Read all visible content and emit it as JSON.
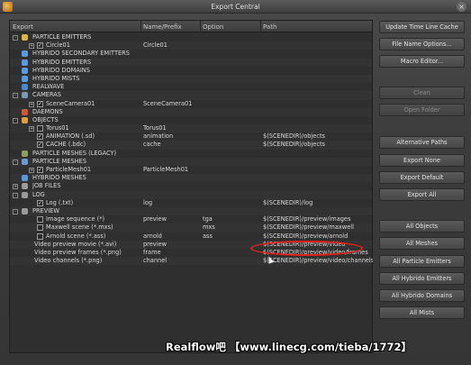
{
  "window": {
    "title": "Export Central"
  },
  "columns": {
    "export": "Export",
    "prefix": "Name/Prefix",
    "option": "Option",
    "path": "Path"
  },
  "rows": [
    {
      "level": "cat",
      "name": "PARTICLE EMITTERS",
      "toggle": "-",
      "checked": true,
      "icon_color": "#d8b64a"
    },
    {
      "level": "item",
      "name": "Circle01",
      "prefix": "Circle01",
      "toggle": "+",
      "checked": true
    },
    {
      "level": "cat",
      "name": "HYBRIDO SECONDARY EMITTERS",
      "icon_color": "#5a9ad8"
    },
    {
      "level": "cat",
      "name": "HYBRIDO EMITTERS",
      "icon_color": "#5a9ad8"
    },
    {
      "level": "cat",
      "name": "HYBRIDO DOMAINS",
      "icon_color": "#5a9ad8"
    },
    {
      "level": "cat",
      "name": "HYBRIDO MISTS",
      "icon_color": "#5a9ad8"
    },
    {
      "level": "cat",
      "name": "REALWAVE",
      "icon_color": "#4a8acd"
    },
    {
      "level": "cat",
      "name": "CAMERAS",
      "toggle": "-",
      "checked": true,
      "icon_color": "#7a9ab8"
    },
    {
      "level": "item",
      "name": "SceneCamera01",
      "prefix": "SceneCamera01",
      "toggle": "+",
      "checked": true
    },
    {
      "level": "cat",
      "name": "DAEMONS",
      "icon_color": "#c85a3a"
    },
    {
      "level": "cat",
      "name": "OBJECTS",
      "toggle": "-",
      "checked": true,
      "icon_color": "#e0a040"
    },
    {
      "level": "item",
      "name": "Torus01",
      "prefix": "Torus01",
      "toggle": "+",
      "checked": false
    },
    {
      "level": "item",
      "name": "ANIMATION (.sd)",
      "prefix": "animation",
      "path": "$(SCENEDIR)/objects",
      "checked": true
    },
    {
      "level": "item",
      "name": "CACHE (.bdc)",
      "prefix": "cache",
      "path": "$(SCENEDIR)/objects",
      "checked": true
    },
    {
      "level": "cat",
      "name": "PARTICLE MESHES (LEGACY)",
      "icon_color": "#8aa060"
    },
    {
      "level": "cat",
      "name": "PARTICLE MESHES",
      "toggle": "-",
      "checked": true,
      "icon_color": "#6a9ad0"
    },
    {
      "level": "item",
      "name": "ParticleMesh01",
      "prefix": "ParticleMesh01",
      "toggle": "+",
      "checked": true
    },
    {
      "level": "cat",
      "name": "HYBRIDO MESHES",
      "icon_color": "#5a9ad8"
    },
    {
      "level": "cat",
      "name": "JOB FILES",
      "toggle": "+",
      "icon_color": "#9a9a9a"
    },
    {
      "level": "cat",
      "name": "LOG",
      "toggle": "-",
      "icon_color": "#9a9a9a"
    },
    {
      "level": "item",
      "name": "Log (.txt)",
      "prefix": "log",
      "path": "$(SCENEDIR)/log",
      "checked": true
    },
    {
      "level": "cat",
      "name": "PREVIEW",
      "toggle": "-",
      "icon_color": "#9a9a9a"
    },
    {
      "level": "item",
      "name": "Image sequence (*)",
      "prefix": "preview",
      "option": "tga",
      "path": "$(SCENEDIR)/preview/images",
      "checked": false
    },
    {
      "level": "item",
      "name": "Maxwell scene (*.mxs)",
      "prefix": "",
      "option": "mxs",
      "path": "$(SCENEDIR)/preview/maxwell",
      "checked": false
    },
    {
      "level": "item",
      "name": "Arnold scene (*.ass)",
      "prefix": "arnold",
      "option": "ass",
      "path": "$(SCENEDIR)/preview/arnold",
      "checked": false,
      "underline": true
    },
    {
      "level": "sub",
      "name": "Video preview movie (*.avi)",
      "prefix": "preview",
      "path": "$(SCENEDIR)/preview/video"
    },
    {
      "level": "sub",
      "name": "Video preview frames (*.png)",
      "prefix": "frame",
      "path": "$(SCENEDIR)/preview/video/frames"
    },
    {
      "level": "sub",
      "name": "Video channels (*.png)",
      "prefix": "channel",
      "path": "$(SCENEDIR)/preview/video/channels"
    }
  ],
  "buttons": [
    {
      "label": "Update Time Line Cache",
      "enabled": true
    },
    {
      "label": "File Name Options...",
      "enabled": true
    },
    {
      "label": "Macro Editor...",
      "enabled": true
    },
    {
      "label": "Clean",
      "enabled": false
    },
    {
      "label": "Open Folder",
      "enabled": false
    },
    {
      "label": "Alternative Paths",
      "enabled": true
    },
    {
      "label": "Export None",
      "enabled": true
    },
    {
      "label": "Export Default",
      "enabled": true
    },
    {
      "label": "Export All",
      "enabled": true
    },
    {
      "label": "All Objects",
      "enabled": true
    },
    {
      "label": "All Meshes",
      "enabled": true
    },
    {
      "label": "All Particle Emitters",
      "enabled": true
    },
    {
      "label": "All Hybrido Emitters",
      "enabled": true
    },
    {
      "label": "All Hybrido Domains",
      "enabled": true
    },
    {
      "label": "All Mists",
      "enabled": true
    }
  ],
  "watermark": "Realflow吧 【www.linecg.com/tieba/1772】",
  "colors": {
    "annotation": "#e0201a",
    "background": "#3a3a3a"
  }
}
